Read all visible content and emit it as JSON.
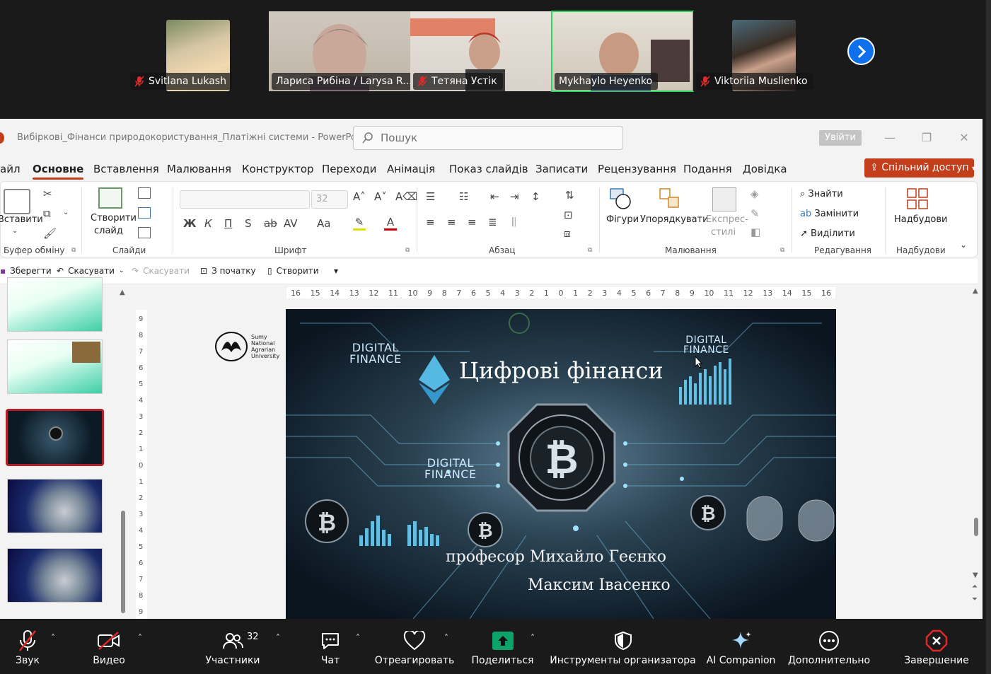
{
  "meeting": {
    "participants_video": [
      {
        "name": "Svitlana Lukash",
        "muted": true,
        "avatar_color": "#d9c39a"
      },
      {
        "name": "Лариса Рибіна / Larysa R...",
        "muted": false,
        "avatar_color": "#b8aca0"
      },
      {
        "name": "Тетяна Устік",
        "muted": true,
        "avatar_color": "#e06a4a"
      },
      {
        "name": "Mykhaylo Heyenko",
        "muted": false,
        "avatar_color": "#c4b9ae",
        "active_speaker": true
      },
      {
        "name": "Viktoriia Muslienko",
        "muted": true,
        "avatar_color": "#5a4b3f"
      }
    ]
  },
  "ppt": {
    "doc_title": "Вибіркові_Фінанси  природокористування_Платіжні системи  -  PowerPoint",
    "search_placeholder": "Пошук",
    "signin_label": "Увійти",
    "menu_tabs": [
      "айл",
      "Основне",
      "Вставлення",
      "Малювання",
      "Конструктор",
      "Переходи",
      "Анімація",
      "Показ слайдів",
      "Записати",
      "Рецензування",
      "Подання",
      "Довідка"
    ],
    "active_tab": "Основне",
    "share_label": "Спільний доступ",
    "ribbon": {
      "clipboard": {
        "paste": "Вставити",
        "label": "Буфер обміну"
      },
      "slides": {
        "new_slide_line1": "Створити",
        "new_slide_line2": "слайд",
        "label": "Слайди"
      },
      "font": {
        "size": "32",
        "label": "Шрифт",
        "bold": "Ж",
        "italic": "К",
        "underline": "П",
        "shadow": "S",
        "strike": "ab",
        "spacing": "AV",
        "case": "Aa"
      },
      "paragraph": {
        "label": "Абзац"
      },
      "drawing": {
        "shapes": "Фігури",
        "arrange": "Упорядкувати",
        "quick_styles_line1": "Експрес-",
        "quick_styles_line2": "стилі",
        "label": "Малювання"
      },
      "editing": {
        "find": "Знайти",
        "replace": "Замінити",
        "select": "Виділити",
        "label": "Редагування"
      },
      "addins": {
        "button": "Надбудови",
        "label": "Надбудови"
      }
    },
    "quick_access": {
      "save": "Зберегти",
      "undo": "Скасувати",
      "redo": "Скасувати",
      "from_start": "З початку",
      "new": "Створити"
    },
    "ruler_h": [
      "16",
      "15",
      "14",
      "13",
      "12",
      "11",
      "10",
      "9",
      "8",
      "7",
      "6",
      "5",
      "4",
      "3",
      "2",
      "1",
      "0",
      "1",
      "2",
      "3",
      "4",
      "5",
      "6",
      "7",
      "8",
      "9",
      "10",
      "11",
      "12",
      "13",
      "14",
      "15",
      "16"
    ],
    "ruler_v": [
      "9",
      "8",
      "7",
      "6",
      "5",
      "4",
      "3",
      "2",
      "1",
      "0",
      "1",
      "2",
      "3",
      "4",
      "5",
      "6",
      "7",
      "8",
      "9"
    ],
    "slide": {
      "title": "Цифрові фінанси",
      "tag_top_left_1": "DIGITAL",
      "tag_top_left_2": "FINANCE",
      "tag_top_right_1": "DIGITAL",
      "tag_top_right_2": "FINANCE",
      "tag_mid_1": "DIGITAL",
      "tag_mid_2": "FINANCE",
      "author1": "професор Михайло Геєнко",
      "author2": "Максим Івасенко",
      "logo_line1": "Sumy",
      "logo_line2": "National",
      "logo_line3": "Agrarian",
      "logo_line4": "University"
    }
  },
  "zoom_toolbar": {
    "audio": "Звук",
    "video": "Видео",
    "participants": "Участники",
    "participants_count": "32",
    "chat": "Чат",
    "react": "Отреагировать",
    "share": "Поделиться",
    "host_tools": "Инструменты организатора",
    "ai": "AI Companion",
    "more": "Дополнительно",
    "end": "Завершение"
  },
  "colors": {
    "accent_ppt": "#c43e1c",
    "zoom_share": "#0ca36a",
    "zoom_end": "#e02828",
    "active_speaker": "#2ad45d",
    "zoom_blue": "#0e71eb"
  }
}
